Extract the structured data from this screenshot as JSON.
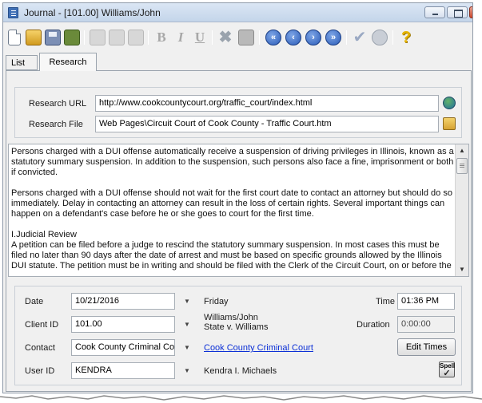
{
  "window": {
    "title": "Journal - [101.00] Williams/John"
  },
  "toolbar": {
    "buttons": [
      {
        "name": "new-document-icon"
      },
      {
        "name": "open-folder-icon"
      },
      {
        "name": "save-icon"
      },
      {
        "name": "print-icon"
      },
      {
        "name": "cut-icon"
      },
      {
        "name": "copy-icon"
      },
      {
        "name": "paste-icon"
      },
      {
        "name": "bold-icon",
        "glyph": "B"
      },
      {
        "name": "italic-icon",
        "glyph": "I"
      },
      {
        "name": "underline-icon",
        "glyph": "U"
      },
      {
        "name": "delete-icon",
        "glyph": "✖"
      },
      {
        "name": "attach-icon"
      },
      {
        "name": "first-record-icon",
        "glyph": "«"
      },
      {
        "name": "previous-record-icon",
        "glyph": "‹"
      },
      {
        "name": "next-record-icon",
        "glyph": "›"
      },
      {
        "name": "last-record-icon",
        "glyph": "»"
      },
      {
        "name": "accept-icon",
        "glyph": "✔"
      },
      {
        "name": "cancel-icon"
      },
      {
        "name": "help-icon",
        "glyph": "?"
      }
    ]
  },
  "tabs": [
    {
      "label": "List",
      "active": false
    },
    {
      "label": "Research",
      "active": true
    }
  ],
  "research": {
    "url_label": "Research URL",
    "url_value": "http://www.cookcountycourt.org/traffic_court/index.html",
    "file_label": "Research File",
    "file_value": "Web Pages\\Circuit Court of Cook County - Traffic Court.htm"
  },
  "notes": {
    "paragraphs": [
      "Persons charged with a DUI offense automatically receive a suspension of driving privileges in Illinois, known as a statutory summary suspension. In addition to the suspension, such persons also face a fine, imprisonment or both if convicted.",
      "Persons charged with a DUI offense should not wait for the first court date to contact an attorney but should do so immediately. Delay in contacting an attorney can result in the loss of certain rights. Several important things can happen on a defendant's case before he or she goes to court for the first time.",
      "I.Judicial Review",
      "A petition can be filed before a judge to rescind the statutory summary suspension. In most cases this must be filed no later than 90 days after the date of arrest and must be based on specific grounds allowed by the Illinois DUI statute. The petition must be in writing and should be filed with the Clerk of the Circuit Court, on or before the"
    ]
  },
  "details": {
    "date_label": "Date",
    "date_value": "10/21/2016",
    "weekday": "Friday",
    "time_label": "Time",
    "time_value": "01:36 PM",
    "client_label": "Client ID",
    "client_value": "101.00",
    "client_name": "Williams/John",
    "client_case": "State v. Williams",
    "duration_label": "Duration",
    "duration_value": "0:00:00",
    "contact_label": "Contact",
    "contact_value": "Cook County Criminal Cou",
    "contact_link": "Cook County Criminal Court",
    "edit_times_label": "Edit Times",
    "user_label": "User ID",
    "user_value": "KENDRA",
    "user_name": "Kendra I. Michaels",
    "spell_label": "Spell",
    "dropdown_glyph": "▼"
  },
  "colors": {
    "link": "#0b2fd6",
    "window_bg": "#f0f0f0",
    "title_bar": "#c4d5ea"
  }
}
